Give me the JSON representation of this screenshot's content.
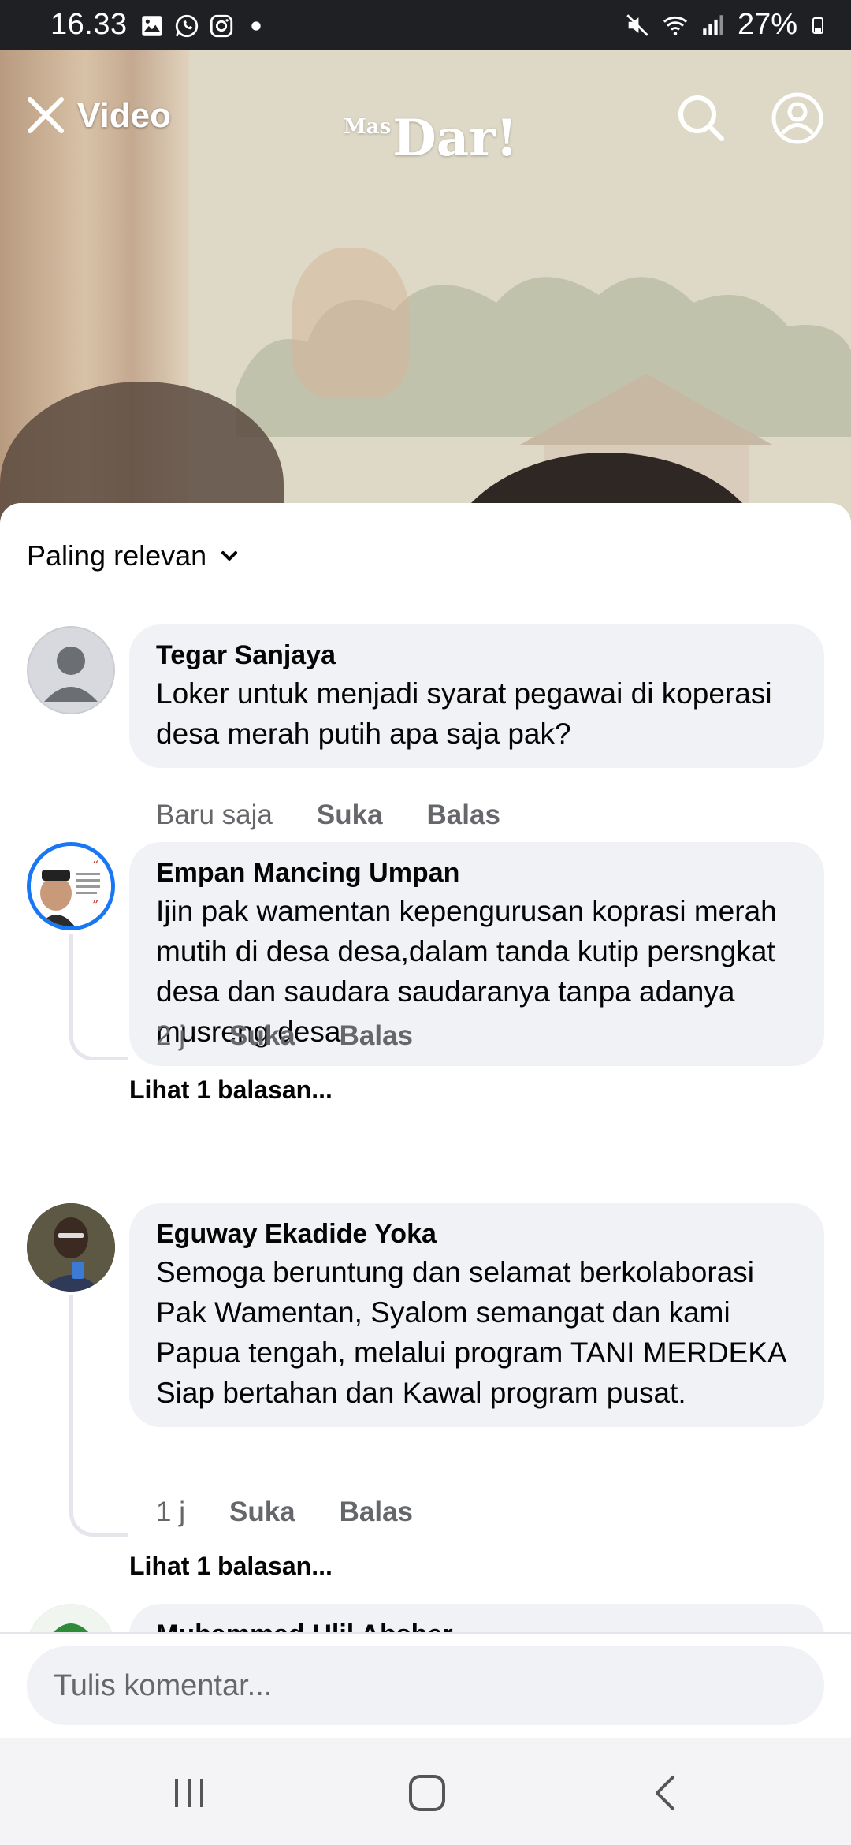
{
  "status_bar": {
    "time": "16.33",
    "battery": "27%",
    "left_icons": [
      "gallery-icon",
      "whatsapp-icon",
      "instagram-icon",
      "dot-icon"
    ],
    "right_icons": [
      "mute-icon",
      "wifi-icon",
      "signal-icon",
      "battery-icon"
    ]
  },
  "header": {
    "title": "Video",
    "logo_small": "Mas",
    "logo": "Dar!"
  },
  "comments": {
    "sort_label": "Paling relevan",
    "items": [
      {
        "author": "Tegar Sanjaya",
        "text": "Loker untuk menjadi syarat pegawai di koperasi desa merah putih apa saja pak?",
        "time": "Baru saja",
        "like": "Suka",
        "reply": "Balas"
      },
      {
        "author": "Empan Mancing Umpan",
        "text": "Ijin pak wamentan kepengurusan koprasi merah mutih di desa desa,dalam tanda kutip persngkat desa dan saudara saudaranya tanpa adanya musreng desa",
        "time": "2 j",
        "like": "Suka",
        "reply": "Balas",
        "replies": "Lihat 1 balasan..."
      },
      {
        "author": "Eguway Ekadide Yoka",
        "text": "Semoga beruntung dan selamat berkolaborasi Pak Wamentan, Syalom semangat dan kami Papua tengah, melalui program TANI MERDEKA Siap bertahan dan Kawal program pusat.",
        "time": "1 j",
        "like": "Suka",
        "reply": "Balas",
        "replies": "Lihat 1 balasan..."
      },
      {
        "author": "Muhammad Ulil Absher"
      }
    ]
  },
  "composer": {
    "placeholder": "Tulis komentar..."
  },
  "nav": {
    "icons": [
      "recents-icon",
      "home-icon",
      "back-icon"
    ]
  }
}
